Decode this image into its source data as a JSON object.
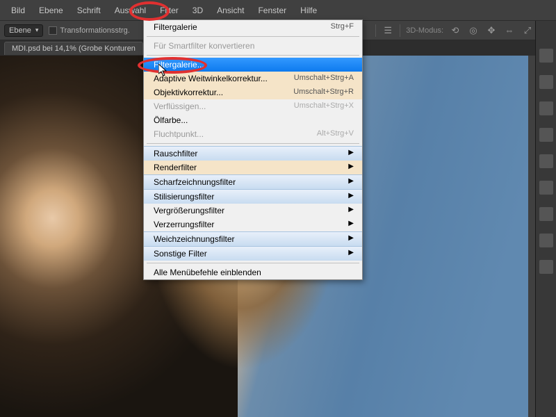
{
  "menubar": {
    "items": [
      "Bild",
      "Ebene",
      "Schrift",
      "Auswahl",
      "Filter",
      "3D",
      "Ansicht",
      "Fenster",
      "Hilfe"
    ]
  },
  "options": {
    "dropdown_label": "Ebene",
    "transform_label": "Transformationsstrg.",
    "mode_3d_label": "3D-Modus:"
  },
  "tab": {
    "title": "MDI.psd bei 14,1% (Grobe Konturen"
  },
  "filter_menu": {
    "top": {
      "label": "Filtergalerie",
      "shortcut": "Strg+F"
    },
    "convert": "Für Smartfilter konvertieren",
    "gallery": "Filtergalerie...",
    "adaptive": {
      "label": "Adaptive Weitwinkelkorrektur...",
      "shortcut": "Umschalt+Strg+A"
    },
    "lens": {
      "label": "Objektivkorrektur...",
      "shortcut": "Umschalt+Strg+R"
    },
    "liquify": {
      "label": "Verflüssigen...",
      "shortcut": "Umschalt+Strg+X"
    },
    "oil": "Ölfarbe...",
    "vanish": {
      "label": "Fluchtpunkt...",
      "shortcut": "Alt+Strg+V"
    },
    "noise": "Rauschfilter",
    "render": "Renderfilter",
    "sharpen": "Scharfzeichnungsfilter",
    "stylize": "Stilisierungsfilter",
    "magnify": "Vergrößerungsfilter",
    "distort": "Verzerrungsfilter",
    "blur": "Weichzeichnungsfilter",
    "other": "Sonstige Filter",
    "show_all": "Alle Menübefehle einblenden"
  }
}
